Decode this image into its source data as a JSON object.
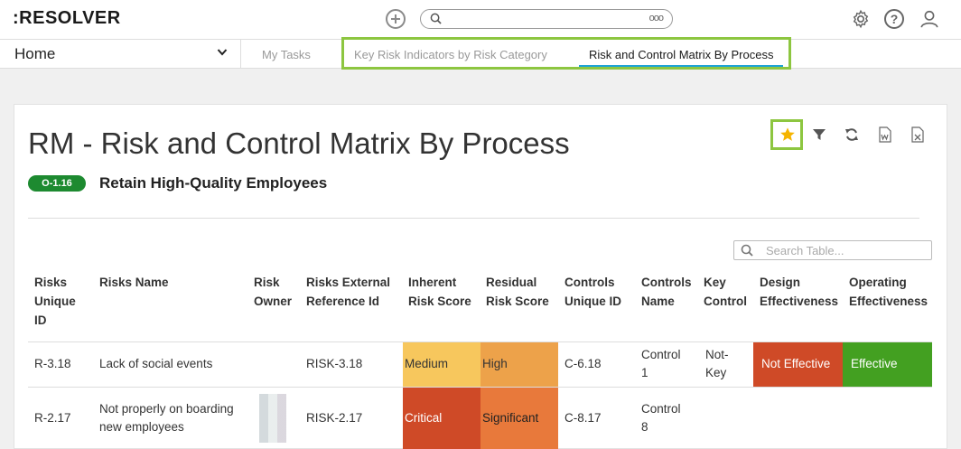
{
  "app": {
    "logo": ":RESOLVER",
    "top_icons": [
      "plus-circle-icon",
      "search-icon",
      "more-icon",
      "gear-icon",
      "help-icon",
      "user-icon"
    ],
    "help_glyph": "?"
  },
  "search": {
    "more_label": "ooo"
  },
  "nav": {
    "home_label": "Home",
    "tabs": [
      {
        "label": "My Tasks"
      },
      {
        "label": "Key Risk Indicators by Risk Category"
      },
      {
        "label": "Risk and Control Matrix By Process",
        "active": true
      }
    ],
    "active_tab_color": "#1ea3d6",
    "highlight_color": "#8dc640"
  },
  "report": {
    "title": "RM - Risk and Control Matrix By Process",
    "process_id": "O-1.16",
    "process_name": "Retain High-Quality Employees",
    "actions": [
      "star-icon",
      "filter-icon",
      "refresh-icon",
      "word-export-icon",
      "excel-export-icon"
    ],
    "search_placeholder": "Search Table..."
  },
  "table": {
    "headers": [
      "Risks Unique ID",
      "Risks Name",
      "Risk Owner",
      "Risks External Reference Id",
      "Inherent Risk Score",
      "Residual Risk Score",
      "Controls Unique ID",
      "Controls Name",
      "Key Control",
      "Design Effectiveness",
      "Operating Effectiveness"
    ],
    "header_lines": [
      [
        "Risks",
        "Unique",
        "ID"
      ],
      [
        "Risks Name"
      ],
      [
        "Risk",
        "Owner"
      ],
      [
        "Risks External",
        "Reference Id"
      ],
      [
        "Inherent",
        "Risk Score"
      ],
      [
        "Residual",
        "Risk Score"
      ],
      [
        "Controls",
        "Unique ID"
      ],
      [
        "Controls",
        "Name"
      ],
      [
        "Key",
        "Control"
      ],
      [
        "Design",
        "Effectiveness"
      ],
      [
        "Operating",
        "Effectiveness"
      ]
    ],
    "rows": [
      {
        "risk_id": "R-3.18",
        "risk_name": "Lack of social events",
        "risk_owner": "",
        "ext_ref": "RISK-3.18",
        "inherent": "Medium",
        "residual": "High",
        "control_id": "C-6.18",
        "control_name_lines": [
          "Control",
          "1"
        ],
        "key_control_lines": [
          "Not-",
          "Key"
        ],
        "design": "Not Effective",
        "operating": "Effective"
      },
      {
        "risk_id": "R-2.17",
        "risk_name_lines": [
          "Not properly on boarding",
          "new employees"
        ],
        "risk_owner": "",
        "ext_ref": "RISK-2.17",
        "inherent": "Critical",
        "residual": "Significant",
        "control_id": "C-8.17",
        "control_name_lines": [
          "Control",
          "8"
        ],
        "key_control_lines": [
          "",
          ""
        ],
        "design": "",
        "operating": ""
      }
    ],
    "colors": {
      "medium": "#f7c75d",
      "high": "#eda24a",
      "critical": "#cf4a27",
      "significant": "#e8793b",
      "not_effective": "#cf4a27",
      "effective": "#43a021",
      "badge": "#1d8a30"
    }
  }
}
